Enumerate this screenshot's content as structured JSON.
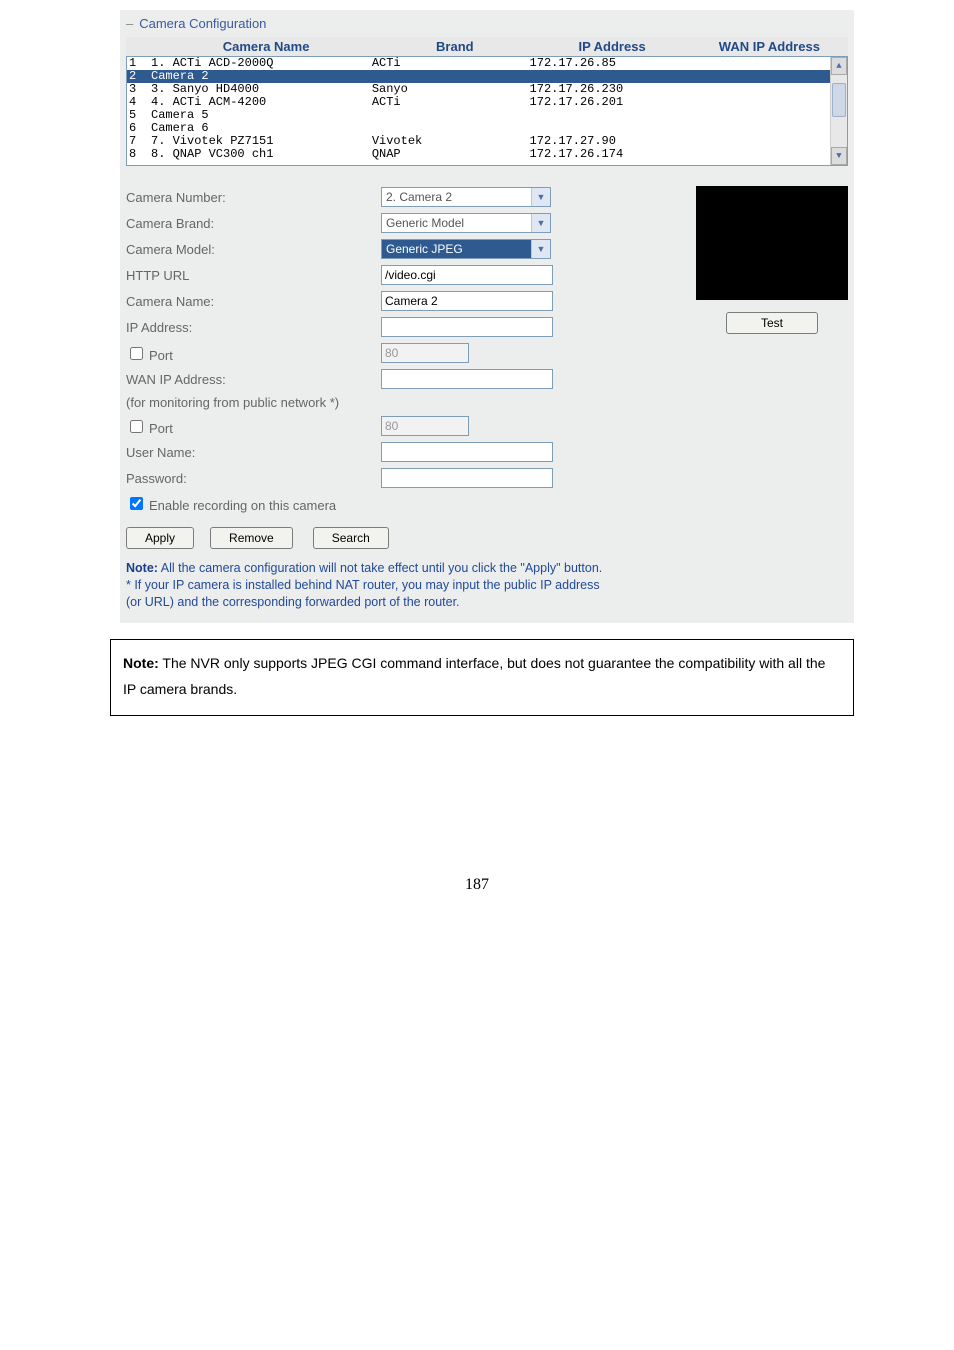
{
  "section_title": "Camera Configuration",
  "dash": "–",
  "headers": {
    "name": "Camera Name",
    "brand": "Brand",
    "ip": "IP Address",
    "wan": "WAN IP Address"
  },
  "rows": [
    {
      "n": "1",
      "name": "1. ACTi ACD-2000Q",
      "brand": "ACTi",
      "ip": "172.17.26.85",
      "wan": ""
    },
    {
      "n": "2",
      "name": "Camera 2",
      "brand": "",
      "ip": "",
      "wan": ""
    },
    {
      "n": "3",
      "name": "3. Sanyo HD4000",
      "brand": "Sanyo",
      "ip": "172.17.26.230",
      "wan": ""
    },
    {
      "n": "4",
      "name": "4. ACTi ACM-4200",
      "brand": "ACTi",
      "ip": "172.17.26.201",
      "wan": ""
    },
    {
      "n": "5",
      "name": "Camera 5",
      "brand": "",
      "ip": "",
      "wan": ""
    },
    {
      "n": "6",
      "name": "Camera 6",
      "brand": "",
      "ip": "",
      "wan": ""
    },
    {
      "n": "7",
      "name": "7. Vivotek PZ7151",
      "brand": "Vivotek",
      "ip": "172.17.27.90",
      "wan": ""
    },
    {
      "n": "8",
      "name": "8. QNAP VC300 ch1",
      "brand": "QNAP",
      "ip": "172.17.26.174",
      "wan": ""
    }
  ],
  "selected_row_index": 1,
  "form": {
    "camera_number_label": "Camera Number:",
    "camera_number_value": "2. Camera 2",
    "camera_brand_label": "Camera Brand:",
    "camera_brand_value": "Generic Model",
    "camera_model_label": "Camera Model:",
    "camera_model_value": "Generic JPEG",
    "http_url_label": "HTTP URL",
    "http_url_value": "/video.cgi",
    "camera_name_label": "Camera Name:",
    "camera_name_value": "Camera 2",
    "ip_label": "IP Address:",
    "ip_value": "",
    "port1_label": "Port",
    "port1_value": "80",
    "wan_label": "WAN IP Address:",
    "wan_value": "",
    "public_note": "(for monitoring from public network *)",
    "port2_label": "Port",
    "port2_value": "80",
    "user_label": "User Name:",
    "user_value": "",
    "pass_label": "Password:",
    "pass_value": "",
    "enable_label": "Enable recording on this camera",
    "enable_checked": true,
    "port1_checked": false,
    "port2_checked": false
  },
  "buttons": {
    "apply": "Apply",
    "remove": "Remove",
    "search": "Search",
    "test": "Test"
  },
  "note_panel": {
    "l1a": "Note:",
    "l1b": " All the camera configuration will not take effect until you click the \"Apply\" button.",
    "l2": "* If your IP camera is installed behind NAT router, you may input the public IP address",
    "l3": "(or URL) and the corresponding forwarded port of the router."
  },
  "outer_note": {
    "prefix": "Note:",
    "body": " The NVR only supports JPEG CGI command interface, but does not guarantee the compatibility with all the IP camera brands."
  },
  "page_number": "187"
}
